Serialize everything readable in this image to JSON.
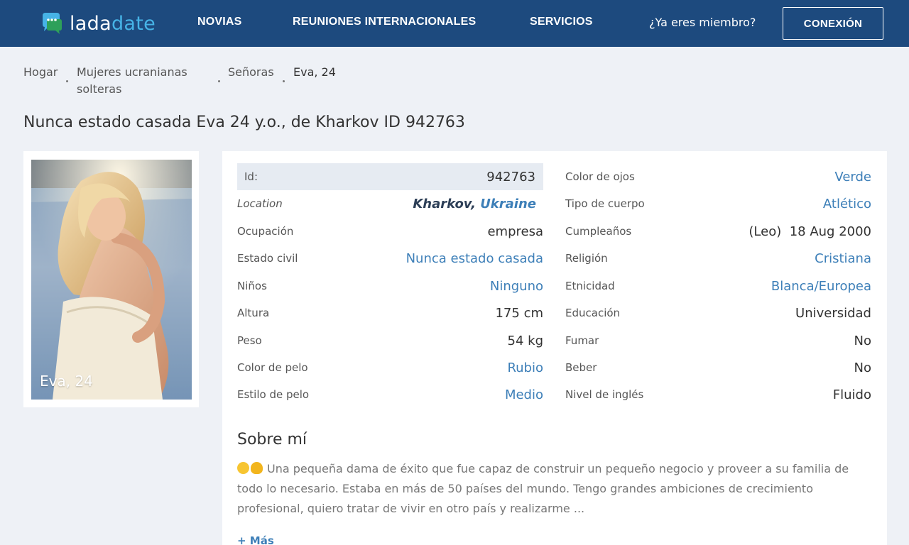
{
  "brand": {
    "part1": "lada",
    "part2": "date"
  },
  "nav": {
    "items": [
      "NOVIAS",
      "REUNIONES INTERNACIONALES",
      "SERVICIOS"
    ],
    "member_question": "¿Ya eres miembro?",
    "login_label": "CONEXIÓN"
  },
  "breadcrumb": [
    "Hogar",
    "Mujeres ucranianas solteras",
    "Señoras",
    "Eva, 24"
  ],
  "page_title": "Nunca estado casada Eva 24 y.o., de Kharkov ID 942763",
  "photo_caption": "Eva, 24",
  "profile": {
    "left": [
      {
        "label": "Id:",
        "value": "942763"
      },
      {
        "label": "Location",
        "city": "Kharkov",
        "sep": ", ",
        "country": "Ukraine"
      },
      {
        "label": "Ocupación",
        "value": "empresa"
      },
      {
        "label": "Estado civil",
        "value": "Nunca estado casada"
      },
      {
        "label": "Niños",
        "value": "Ninguno"
      },
      {
        "label": "Altura",
        "value": "175 cm"
      },
      {
        "label": "Peso",
        "value": "54 kg"
      },
      {
        "label": "Color de pelo",
        "value": "Rubio"
      },
      {
        "label": "Estilo de pelo",
        "value": "Medio"
      }
    ],
    "right": [
      {
        "label": "Color de ojos",
        "value": "Verde"
      },
      {
        "label": "Tipo de cuerpo",
        "value": "Atlético"
      },
      {
        "label": "Cumpleaños",
        "value": "(Leo)  18 Aug 2000"
      },
      {
        "label": "Religión",
        "value": "Cristiana"
      },
      {
        "label": "Etnicidad",
        "value": "Blanca/Europea"
      },
      {
        "label": "Educación",
        "value": "Universidad"
      },
      {
        "label": "Fumar",
        "value": "No"
      },
      {
        "label": "Beber",
        "value": "No"
      },
      {
        "label": "Nivel de inglés",
        "value": "Fluido"
      }
    ]
  },
  "about": {
    "title": "Sobre mí",
    "text": "Una pequeña dama de éxito que fue capaz de construir un pequeño negocio y proveer a su familia de todo lo necesario. Estaba en más de 50 países del mundo. Tengo grandes ambiciones de crecimiento profesional, quiero tratar de vivir en otro país y realizarme",
    "ellipsis": "...",
    "more_label": "+ Más"
  },
  "colors": {
    "header_bg": "#1d4a7e",
    "accent": "#46b3e6",
    "link": "#3d7fb8",
    "page_bg": "#eef1f6"
  }
}
